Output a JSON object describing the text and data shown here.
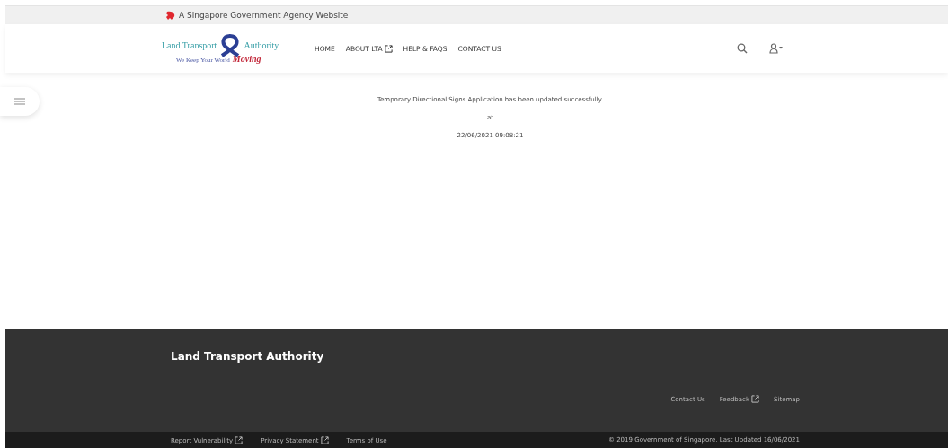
{
  "masthead": {
    "text": "A Singapore Government Agency Website"
  },
  "header": {
    "logo": {
      "name_left": "Land Transport",
      "name_right": "Authority",
      "tagline": "We Keep Your World",
      "tagline_script": "Moving"
    },
    "nav": [
      {
        "label": "HOME",
        "external": false
      },
      {
        "label": "ABOUT LTA",
        "external": true
      },
      {
        "label": "HELP & FAQS",
        "external": false
      },
      {
        "label": "CONTACT US",
        "external": false
      }
    ]
  },
  "message": {
    "lines": [
      "Temporary Directional Signs Application has been updated successfully.",
      "at",
      "22/06/2021 09:08:21"
    ]
  },
  "footer": {
    "title": "Land Transport Authority",
    "links": [
      {
        "label": "Contact Us",
        "external": false
      },
      {
        "label": "Feedback",
        "external": true
      },
      {
        "label": "Sitemap",
        "external": false
      }
    ],
    "bottom_links": [
      {
        "label": "Report Vulnerability",
        "external": true
      },
      {
        "label": "Privacy Statement",
        "external": true
      },
      {
        "label": "Terms of Use",
        "external": false
      }
    ],
    "copyright": "© 2019 Government of Singapore. Last Updated 16/06/2021"
  }
}
